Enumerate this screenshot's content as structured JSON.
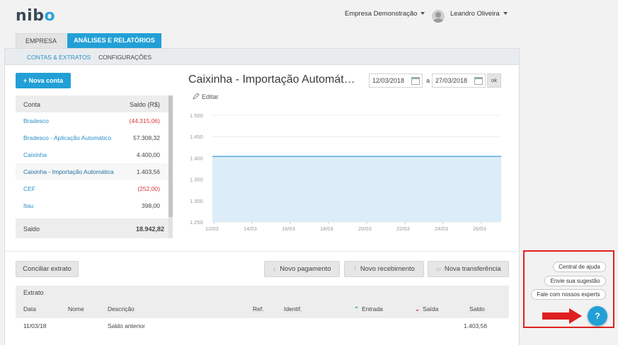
{
  "header": {
    "logo": "nibo",
    "company": "Empresa Demonstração",
    "user": "Leandro Oliveira"
  },
  "tabs": [
    {
      "label": "EMPRESA",
      "active": false
    },
    {
      "label": "ANÁLISES E RELATÓRIOS",
      "active": true
    }
  ],
  "subtabs": [
    {
      "label": "CONTAS & EXTRATOS",
      "active": true
    },
    {
      "label": "CONFIGURAÇÕES",
      "active": false
    }
  ],
  "accounts": {
    "new_button": "+ Nova conta",
    "col_account": "Conta",
    "col_balance": "Saldo (R$)",
    "rows": [
      {
        "name": "Bradesco",
        "balance": "(44.315,06)",
        "negative": true
      },
      {
        "name": "Bradesco - Aplicação Automático",
        "balance": "57.308,32",
        "negative": false
      },
      {
        "name": "Caixinha",
        "balance": "4.400,00",
        "negative": false
      },
      {
        "name": "Caixinha - Importação Automática",
        "balance": "1.403,56",
        "negative": false
      },
      {
        "name": "CEF",
        "balance": "(252,00)",
        "negative": true
      },
      {
        "name": "Itau",
        "balance": "398,00",
        "negative": false
      }
    ],
    "total_label": "Saldo",
    "total_value": "18.942,82"
  },
  "chart_header": {
    "title": "Caixinha - Importação Automát…",
    "edit_label": "Editar",
    "date_from": "12/03/2018",
    "date_sep": "a",
    "date_to": "27/03/2018",
    "ok_label": "ok"
  },
  "chart_data": {
    "type": "area",
    "x_ticks": [
      "12/03",
      "14/03",
      "16/03",
      "18/03",
      "20/03",
      "22/03",
      "24/03",
      "26/03"
    ],
    "y_ticks": [
      "1.500",
      "1.450",
      "1.400",
      "1.350",
      "1.300",
      "1.250"
    ],
    "ylim": [
      1250,
      1500
    ],
    "series": [
      {
        "values": [
          1403.56,
          1403.56,
          1403.56,
          1403.56,
          1403.56,
          1403.56,
          1403.56,
          1403.56,
          1403.56,
          1403.56,
          1403.56,
          1403.56,
          1403.56,
          1403.56,
          1403.56,
          1403.56
        ]
      }
    ],
    "line_color": "#5aa9dc",
    "fill_color": "#dcedf9",
    "grid": true
  },
  "actions": {
    "reconcile": "Conciliar extrato",
    "new_payment": "Novo pagamento",
    "new_receipt": "Novo recebimento",
    "new_transfer": "Nova transferência"
  },
  "statement": {
    "title": "Extrato",
    "columns": [
      "Data",
      "Nome",
      "Descrição",
      "Ref.",
      "Identif.",
      "Entrada",
      "Saída",
      "Saldo"
    ],
    "rows": [
      {
        "date": "11/03/18",
        "name": "",
        "description": "Saldo anterior",
        "ref": "",
        "identif": "",
        "in": "",
        "out": "",
        "balance": "1.403,56"
      }
    ]
  },
  "help": {
    "help_center": "Central de ajuda",
    "suggestion": "Envie sua sugestão",
    "experts": "Fale com nossos experts",
    "help_button": "?"
  },
  "colors": {
    "accent": "#22a0d6",
    "negative": "#d9363e",
    "highlight_box": "#e02020",
    "arrow": "#e02020",
    "in_green": "#2aa24a",
    "out_red": "#d9363e"
  }
}
